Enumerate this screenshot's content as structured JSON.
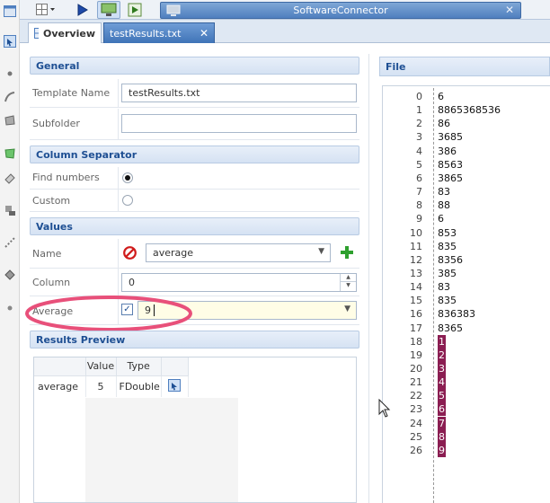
{
  "title_bar": {
    "title": "SoftwareConnector",
    "close_glyph": "✕"
  },
  "tabs": [
    {
      "label": "Overview",
      "icon": "grid-icon",
      "active": false
    },
    {
      "label": "testResults.txt",
      "close_glyph": "✕",
      "active": true
    }
  ],
  "sections": {
    "general": {
      "title": "General",
      "template_name_label": "Template Name",
      "template_name_value": "testResults.txt",
      "subfolder_label": "Subfolder",
      "subfolder_value": ""
    },
    "column_separator": {
      "title": "Column Separator",
      "find_numbers_label": "Find numbers",
      "find_numbers_selected": true,
      "custom_label": "Custom",
      "custom_selected": false
    },
    "values": {
      "title": "Values",
      "name_label": "Name",
      "name_value": "average",
      "column_label": "Column",
      "column_value": "0",
      "average_label": "Average",
      "average_checked": true,
      "average_value": "9",
      "check_glyph": "✓"
    },
    "results_preview": {
      "title": "Results Preview",
      "columns": [
        "",
        "Value",
        "Type",
        ""
      ],
      "rows": [
        {
          "name": "average",
          "value": "5",
          "type": "FDouble"
        }
      ]
    }
  },
  "file_panel": {
    "title": "File",
    "lines": [
      {
        "num": "0",
        "text": "6",
        "hl": false
      },
      {
        "num": "1",
        "text": "8865368536",
        "hl": false
      },
      {
        "num": "2",
        "text": "86",
        "hl": false
      },
      {
        "num": "3",
        "text": "3685",
        "hl": false
      },
      {
        "num": "4",
        "text": "386",
        "hl": false
      },
      {
        "num": "5",
        "text": "8563",
        "hl": false
      },
      {
        "num": "6",
        "text": "3865",
        "hl": false
      },
      {
        "num": "7",
        "text": "83",
        "hl": false
      },
      {
        "num": "8",
        "text": "88",
        "hl": false
      },
      {
        "num": "9",
        "text": "6",
        "hl": false
      },
      {
        "num": "10",
        "text": "853",
        "hl": false
      },
      {
        "num": "11",
        "text": "835",
        "hl": false
      },
      {
        "num": "12",
        "text": "8356",
        "hl": false
      },
      {
        "num": "13",
        "text": "385",
        "hl": false
      },
      {
        "num": "14",
        "text": "83",
        "hl": false
      },
      {
        "num": "15",
        "text": "835",
        "hl": false
      },
      {
        "num": "16",
        "text": "836383",
        "hl": false
      },
      {
        "num": "17",
        "text": "8365",
        "hl": false
      },
      {
        "num": "18",
        "text": "1",
        "hl": true
      },
      {
        "num": "19",
        "text": "2",
        "hl": true
      },
      {
        "num": "20",
        "text": "3",
        "hl": true
      },
      {
        "num": "21",
        "text": "4",
        "hl": true
      },
      {
        "num": "22",
        "text": "5",
        "hl": true
      },
      {
        "num": "23",
        "text": "6",
        "hl": true
      },
      {
        "num": "24",
        "text": "7",
        "hl": true
      },
      {
        "num": "25",
        "text": "8",
        "hl": true
      },
      {
        "num": "26",
        "text": "9",
        "hl": true
      }
    ]
  },
  "colors": {
    "accent": "#3f73b7",
    "section_text": "#1e4f93",
    "highlight_bg": "#8b1e52",
    "annotation_ring": "#e8507a",
    "add_green": "#2ea02e",
    "stop_red": "#d01c1c"
  }
}
